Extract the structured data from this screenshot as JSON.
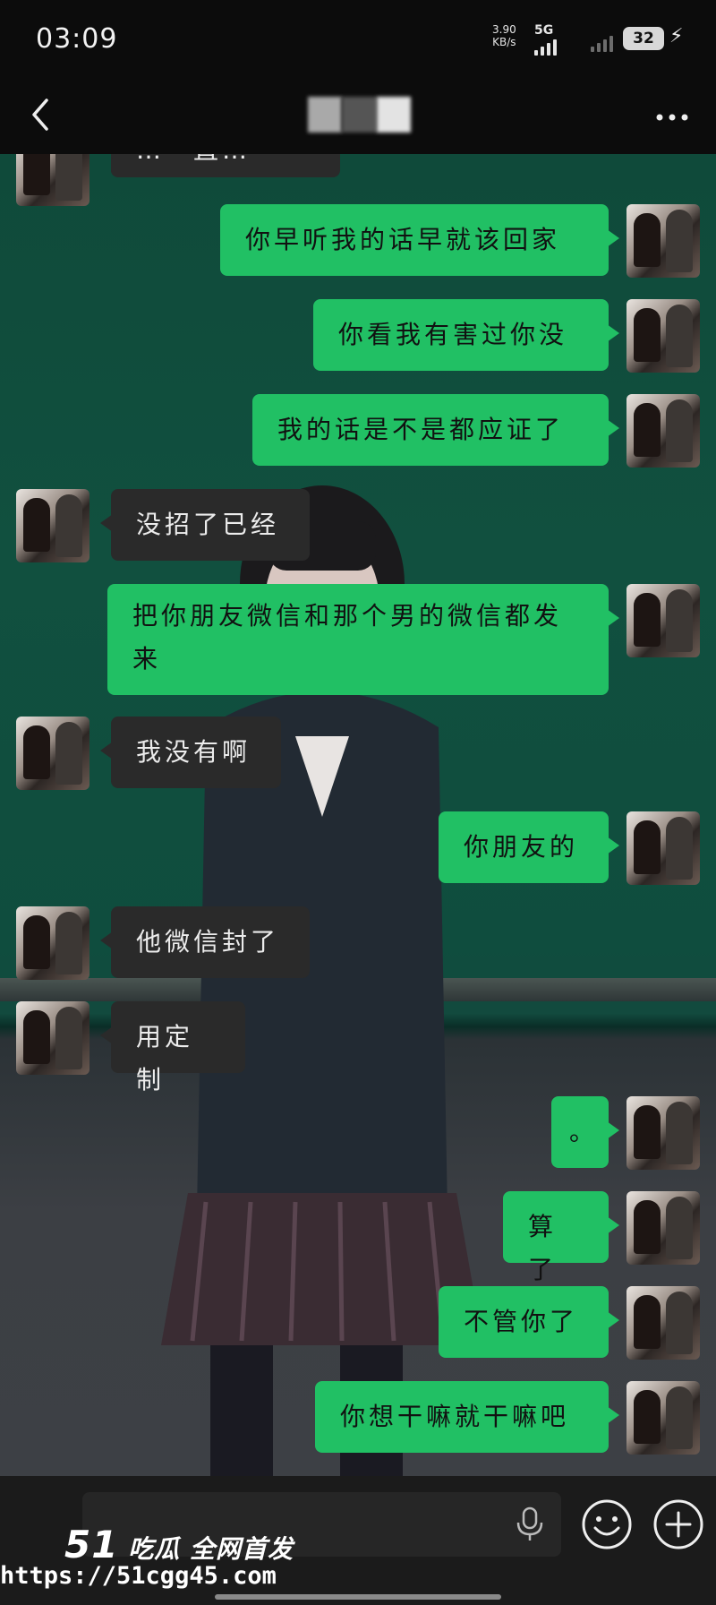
{
  "status": {
    "time": "03:09",
    "net_speed_value": "3.90",
    "net_speed_unit": "KB/s",
    "network": "5G",
    "battery": "32"
  },
  "messages": [
    {
      "side": "in",
      "text": "…一直…"
    },
    {
      "side": "out",
      "text": "你早听我的话早就该回家"
    },
    {
      "side": "out",
      "text": "你看我有害过你没"
    },
    {
      "side": "out",
      "text": "我的话是不是都应证了"
    },
    {
      "side": "in",
      "text": "没招了已经"
    },
    {
      "side": "out",
      "text": "把你朋友微信和那个男的微信都发来"
    },
    {
      "side": "in",
      "text": "我没有啊"
    },
    {
      "side": "out",
      "text": "你朋友的"
    },
    {
      "side": "in",
      "text": "他微信封了"
    },
    {
      "side": "in",
      "text": "用定制"
    },
    {
      "side": "out",
      "text": "。"
    },
    {
      "side": "out",
      "text": "算了"
    },
    {
      "side": "out",
      "text": "不管你了"
    },
    {
      "side": "out",
      "text": "你想干嘛就干嘛吧"
    }
  ],
  "watermark": {
    "logo_number": "51",
    "logo_text": "吃瓜 全网首发",
    "url": "https://51cgg45.com"
  },
  "icons": [
    "back-icon",
    "more-icon",
    "mic-icon",
    "emoji-icon",
    "plus-icon"
  ]
}
